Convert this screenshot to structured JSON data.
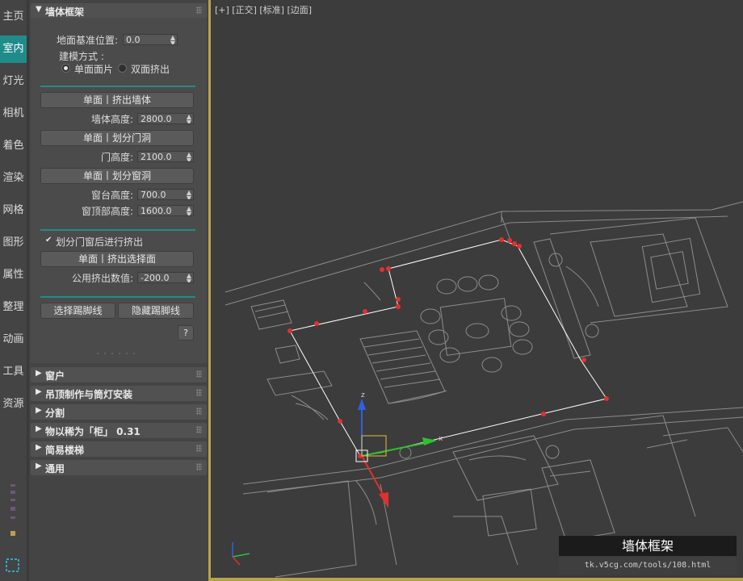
{
  "side_tabs": {
    "items": [
      {
        "label": "主页"
      },
      {
        "label": "室内"
      },
      {
        "label": "灯光"
      },
      {
        "label": "相机"
      },
      {
        "label": "着色"
      },
      {
        "label": "渲染"
      },
      {
        "label": "网格"
      },
      {
        "label": "图形"
      },
      {
        "label": "属性"
      },
      {
        "label": "整理"
      },
      {
        "label": "动画"
      },
      {
        "label": "工具"
      },
      {
        "label": "资源"
      }
    ],
    "active": "室内"
  },
  "wall_frame": {
    "title": "墙体框架",
    "floor_base_label": "地面基准位置:",
    "floor_base_value": "0.0",
    "modeling_label": "建模方式 :",
    "option_single": "单面面片",
    "option_double": "双面挤出",
    "selected_option": "单面面片",
    "btn_extrude_wall": "单面丨挤出墙体",
    "wall_height_label": "墙体高度:",
    "wall_height_value": "2800.0",
    "btn_door_opening": "单面丨划分门洞",
    "door_height_label": "门高度:",
    "door_height_value": "2100.0",
    "btn_window_opening": "单面丨划分窗洞",
    "sill_height_label": "窗台高度:",
    "sill_height_value": "700.0",
    "window_top_label": "窗顶部高度:",
    "window_top_value": "1600.0",
    "checkbox_label": "划分门窗后进行挤出",
    "checkbox_checked": true,
    "btn_extrude_selection": "单面丨挤出选择面",
    "common_extrude_label": "公用挤出数值:",
    "common_extrude_value": "-200.0",
    "btn_select_skirting": "选择踢脚线",
    "btn_hide_skirting": "隐藏踢脚线",
    "help": "?"
  },
  "collapsed_rollouts": [
    {
      "title": "窗户"
    },
    {
      "title": "吊顶制作与筒灯安装"
    },
    {
      "title": "分割"
    },
    {
      "title": "物以稀为「柜」 0.31"
    },
    {
      "title": "简易楼梯"
    },
    {
      "title": "通用"
    }
  ],
  "viewport": {
    "label": "[+] [正交] [标准] [边面]"
  },
  "tool_box": {
    "name": "墙体框架",
    "url": "tk.v5cg.com/tools/108.html"
  },
  "colors": {
    "accent": "#1f8c8a",
    "viewport_border": "#b8a24b",
    "vertex": "#e23030"
  },
  "icons": [
    "expand-arrow-icon",
    "grip-icon",
    "gizmo-z-arrow-icon",
    "gizmo-x-arrow-icon",
    "gizmo-y-arrow-icon",
    "axis-tripod-icon",
    "selection-box-icon"
  ]
}
